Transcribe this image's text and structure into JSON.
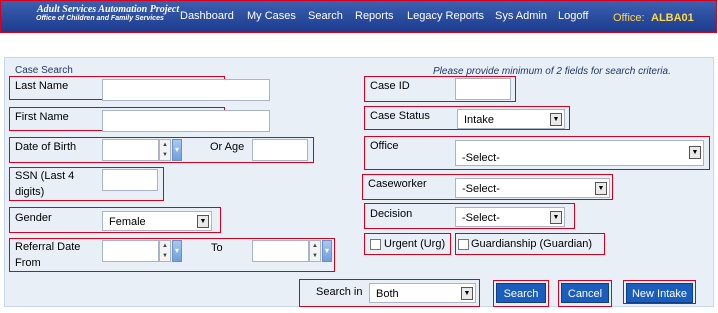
{
  "header": {
    "logo_line1": "Adult Services Automation Project",
    "logo_line2": "Office of Children and Family Services",
    "nav": [
      "Dashboard",
      "My Cases",
      "Search",
      "Reports",
      "Legacy Reports",
      "Sys Admin",
      "Logoff"
    ],
    "office_label": "Office:",
    "office_value": "ALBA01"
  },
  "panel": {
    "title": "Case Search",
    "hint": "Please provide minimum of 2 fields for search criteria."
  },
  "fields": {
    "last_name": {
      "label": "Last Name",
      "value": ""
    },
    "first_name": {
      "label": "First Name",
      "value": ""
    },
    "dob": {
      "label": "Date of Birth",
      "value": ""
    },
    "or_age": {
      "label": "Or Age",
      "value": ""
    },
    "ssn": {
      "label": "SSN (Last 4 digits)",
      "value": ""
    },
    "gender": {
      "label": "Gender",
      "value": "Female"
    },
    "referral_from": {
      "label": "Referral Date From",
      "value": ""
    },
    "referral_to": {
      "label": "To",
      "value": ""
    },
    "case_id": {
      "label": "Case ID",
      "value": ""
    },
    "case_status": {
      "label": "Case Status",
      "value": "Intake"
    },
    "office": {
      "label": "Office",
      "value": "-Select-"
    },
    "caseworker": {
      "label": "Caseworker",
      "value": "-Select-"
    },
    "decision": {
      "label": "Decision",
      "value": "-Select-"
    },
    "urgent": {
      "label": "Urgent (Urg)",
      "checked": false
    },
    "guardianship": {
      "label": "Guardianship (Guardian)",
      "checked": false
    },
    "search_in": {
      "label": "Search in",
      "value": "Both"
    }
  },
  "buttons": {
    "search": "Search",
    "cancel": "Cancel",
    "new_intake": "New Intake"
  },
  "colors": {
    "header_blue": "#1d3d8f",
    "highlight_red": "#d9001e",
    "button_blue": "#1a5dbd",
    "office_yellow": "#ffd84a",
    "panel_bg": "#e9eff7"
  }
}
